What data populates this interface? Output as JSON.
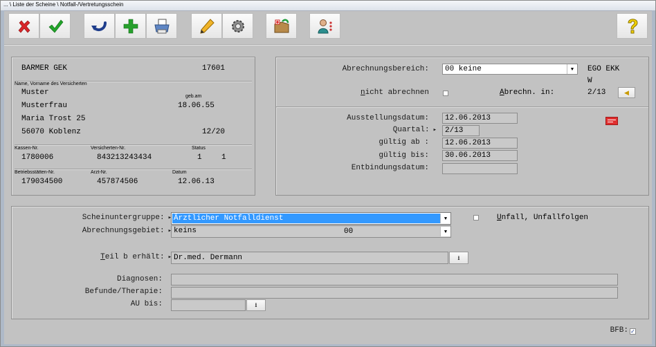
{
  "window": {
    "title": "... \\ Liste der Scheine \\ Notfall-/Vertretungsschein"
  },
  "toolbar": {
    "buttons": [
      {
        "name": "cancel",
        "icon": "red-x-icon"
      },
      {
        "name": "confirm",
        "icon": "green-check-icon"
      },
      {
        "name": "undo",
        "icon": "undo-arrow-icon"
      },
      {
        "name": "add",
        "icon": "green-plus-icon"
      },
      {
        "name": "print",
        "icon": "printer-icon"
      },
      {
        "name": "edit",
        "icon": "pencil-icon"
      },
      {
        "name": "settings",
        "icon": "gear-icon"
      },
      {
        "name": "transfer",
        "icon": "box-transfer-icon"
      },
      {
        "name": "patient",
        "icon": "person-icon"
      },
      {
        "name": "help",
        "icon": "question-mark-icon"
      }
    ]
  },
  "insurance": {
    "kasse_name": "BARMER GEK",
    "kasse_code": "17601",
    "name_header": "Name, Vorname des Versicherten",
    "name_last": "Muster",
    "name_first": "Musterfrau",
    "street": "Maria Trost 25",
    "city": "56070 Koblenz",
    "geb_label": "geb.am",
    "geb_date": "18.06.55",
    "valid_until": "12/20",
    "kassen_nr_label": "Kassen-Nr.",
    "kassen_nr": "1780006",
    "versicherten_nr_label": "Versicherten-Nr.",
    "versicherten_nr": "843213243434",
    "status_label": "Status",
    "status_1": "1",
    "status_2": "1",
    "bsnr_label": "Betriebsstätten-Nr.",
    "bsnr": "179034500",
    "arzt_nr_label": "Arzt-Nr.",
    "arzt_nr": "457874506",
    "datum_label": "Datum",
    "datum": "12.06.13"
  },
  "billing": {
    "abrechnungsbereich_label": "Abrechnungsbereich:",
    "abrechnungsbereich_value": "00 keine",
    "ego": "EGO EKK",
    "ego_sub": "W",
    "nicht_abrechnen_key": "n",
    "nicht_abrechnen_rest": "icht abrechnen",
    "abrechn_in_key": "A",
    "abrechn_in_rest": "brechn. in:",
    "abrechn_in_value": "2/13",
    "ausstellungsdatum_label": "Ausstellungsdatum:",
    "ausstellungsdatum": "12.06.2013",
    "quartal_label": "Quartal:",
    "quartal": "2/13",
    "gueltig_ab_label": "gültig ab :",
    "gueltig_ab": "12.06.2013",
    "gueltig_bis_label": "gültig bis:",
    "gueltig_bis": "30.06.2013",
    "entbindungsdatum_label": "Entbindungsdatum:",
    "entbindungsdatum": ""
  },
  "schein": {
    "untergruppe_label": "Scheinuntergruppe:",
    "untergruppe_value": "Ärztlicher Notfalldienst",
    "unfall_key": "U",
    "unfall_rest": "nfall, Unfallfolgen",
    "gebiet_label": "Abrechnungsgebiet:",
    "gebiet_value": "keins",
    "gebiet_code": "00",
    "teil_b_key": "T",
    "teil_b_rest": "eil b erhält:",
    "teil_b_value": "Dr.med. Dermann",
    "diagnosen_label": "Diagnosen:",
    "diagnosen": "",
    "befunde_label": "Befunde/Therapie:",
    "befunde": "",
    "au_label": "AU bis:",
    "au_value": ""
  },
  "footer": {
    "bfb_label": "BFB:",
    "bfb_checked": true
  },
  "colors": {
    "background": "#c2c2c2",
    "selection": "#3399ff",
    "card_icon": "#e03030"
  }
}
